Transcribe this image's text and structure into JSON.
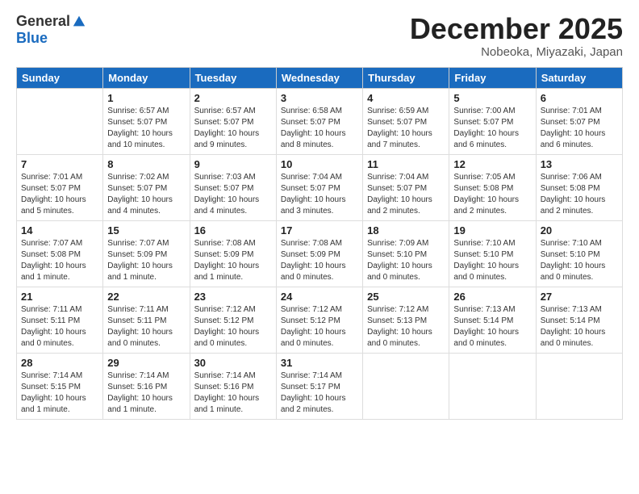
{
  "header": {
    "logo_general": "General",
    "logo_blue": "Blue",
    "month_title": "December 2025",
    "location": "Nobeoka, Miyazaki, Japan"
  },
  "calendar": {
    "days_of_week": [
      "Sunday",
      "Monday",
      "Tuesday",
      "Wednesday",
      "Thursday",
      "Friday",
      "Saturday"
    ],
    "weeks": [
      [
        {
          "day": "",
          "info": ""
        },
        {
          "day": "1",
          "info": "Sunrise: 6:57 AM\nSunset: 5:07 PM\nDaylight: 10 hours\nand 10 minutes."
        },
        {
          "day": "2",
          "info": "Sunrise: 6:57 AM\nSunset: 5:07 PM\nDaylight: 10 hours\nand 9 minutes."
        },
        {
          "day": "3",
          "info": "Sunrise: 6:58 AM\nSunset: 5:07 PM\nDaylight: 10 hours\nand 8 minutes."
        },
        {
          "day": "4",
          "info": "Sunrise: 6:59 AM\nSunset: 5:07 PM\nDaylight: 10 hours\nand 7 minutes."
        },
        {
          "day": "5",
          "info": "Sunrise: 7:00 AM\nSunset: 5:07 PM\nDaylight: 10 hours\nand 6 minutes."
        },
        {
          "day": "6",
          "info": "Sunrise: 7:01 AM\nSunset: 5:07 PM\nDaylight: 10 hours\nand 6 minutes."
        }
      ],
      [
        {
          "day": "7",
          "info": "Sunrise: 7:01 AM\nSunset: 5:07 PM\nDaylight: 10 hours\nand 5 minutes."
        },
        {
          "day": "8",
          "info": "Sunrise: 7:02 AM\nSunset: 5:07 PM\nDaylight: 10 hours\nand 4 minutes."
        },
        {
          "day": "9",
          "info": "Sunrise: 7:03 AM\nSunset: 5:07 PM\nDaylight: 10 hours\nand 4 minutes."
        },
        {
          "day": "10",
          "info": "Sunrise: 7:04 AM\nSunset: 5:07 PM\nDaylight: 10 hours\nand 3 minutes."
        },
        {
          "day": "11",
          "info": "Sunrise: 7:04 AM\nSunset: 5:07 PM\nDaylight: 10 hours\nand 2 minutes."
        },
        {
          "day": "12",
          "info": "Sunrise: 7:05 AM\nSunset: 5:08 PM\nDaylight: 10 hours\nand 2 minutes."
        },
        {
          "day": "13",
          "info": "Sunrise: 7:06 AM\nSunset: 5:08 PM\nDaylight: 10 hours\nand 2 minutes."
        }
      ],
      [
        {
          "day": "14",
          "info": "Sunrise: 7:07 AM\nSunset: 5:08 PM\nDaylight: 10 hours\nand 1 minute."
        },
        {
          "day": "15",
          "info": "Sunrise: 7:07 AM\nSunset: 5:09 PM\nDaylight: 10 hours\nand 1 minute."
        },
        {
          "day": "16",
          "info": "Sunrise: 7:08 AM\nSunset: 5:09 PM\nDaylight: 10 hours\nand 1 minute."
        },
        {
          "day": "17",
          "info": "Sunrise: 7:08 AM\nSunset: 5:09 PM\nDaylight: 10 hours\nand 0 minutes."
        },
        {
          "day": "18",
          "info": "Sunrise: 7:09 AM\nSunset: 5:10 PM\nDaylight: 10 hours\nand 0 minutes."
        },
        {
          "day": "19",
          "info": "Sunrise: 7:10 AM\nSunset: 5:10 PM\nDaylight: 10 hours\nand 0 minutes."
        },
        {
          "day": "20",
          "info": "Sunrise: 7:10 AM\nSunset: 5:10 PM\nDaylight: 10 hours\nand 0 minutes."
        }
      ],
      [
        {
          "day": "21",
          "info": "Sunrise: 7:11 AM\nSunset: 5:11 PM\nDaylight: 10 hours\nand 0 minutes."
        },
        {
          "day": "22",
          "info": "Sunrise: 7:11 AM\nSunset: 5:11 PM\nDaylight: 10 hours\nand 0 minutes."
        },
        {
          "day": "23",
          "info": "Sunrise: 7:12 AM\nSunset: 5:12 PM\nDaylight: 10 hours\nand 0 minutes."
        },
        {
          "day": "24",
          "info": "Sunrise: 7:12 AM\nSunset: 5:12 PM\nDaylight: 10 hours\nand 0 minutes."
        },
        {
          "day": "25",
          "info": "Sunrise: 7:12 AM\nSunset: 5:13 PM\nDaylight: 10 hours\nand 0 minutes."
        },
        {
          "day": "26",
          "info": "Sunrise: 7:13 AM\nSunset: 5:14 PM\nDaylight: 10 hours\nand 0 minutes."
        },
        {
          "day": "27",
          "info": "Sunrise: 7:13 AM\nSunset: 5:14 PM\nDaylight: 10 hours\nand 0 minutes."
        }
      ],
      [
        {
          "day": "28",
          "info": "Sunrise: 7:14 AM\nSunset: 5:15 PM\nDaylight: 10 hours\nand 1 minute."
        },
        {
          "day": "29",
          "info": "Sunrise: 7:14 AM\nSunset: 5:16 PM\nDaylight: 10 hours\nand 1 minute."
        },
        {
          "day": "30",
          "info": "Sunrise: 7:14 AM\nSunset: 5:16 PM\nDaylight: 10 hours\nand 1 minute."
        },
        {
          "day": "31",
          "info": "Sunrise: 7:14 AM\nSunset: 5:17 PM\nDaylight: 10 hours\nand 2 minutes."
        },
        {
          "day": "",
          "info": ""
        },
        {
          "day": "",
          "info": ""
        },
        {
          "day": "",
          "info": ""
        }
      ]
    ]
  }
}
